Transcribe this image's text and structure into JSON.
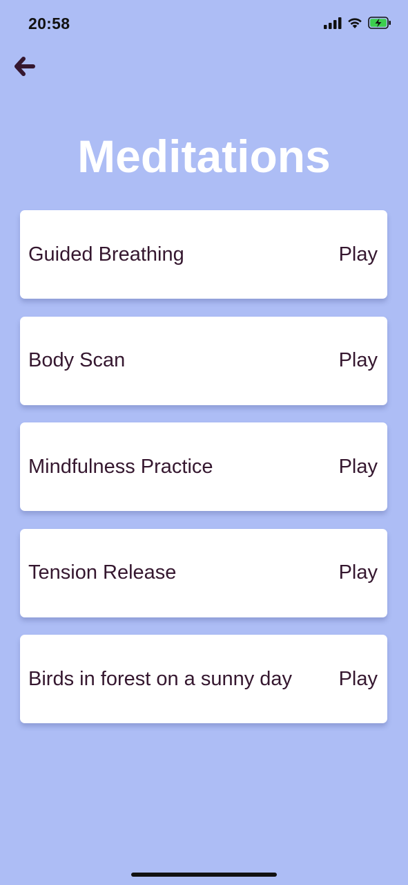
{
  "status_bar": {
    "time": "20:58",
    "battery_color": "#3ccf4e"
  },
  "header": {
    "back_icon": "arrow-left-icon",
    "title": "Meditations"
  },
  "meditations": [
    {
      "title": "Guided Breathing",
      "action": "Play"
    },
    {
      "title": "Body Scan",
      "action": "Play"
    },
    {
      "title": "Mindfulness Practice",
      "action": "Play"
    },
    {
      "title": "Tension Release",
      "action": "Play"
    },
    {
      "title": "Birds in forest on a sunny day",
      "action": "Play"
    }
  ],
  "colors": {
    "background": "#adbdf5",
    "card": "#ffffff",
    "text": "#35172f",
    "title": "#ffffff"
  }
}
